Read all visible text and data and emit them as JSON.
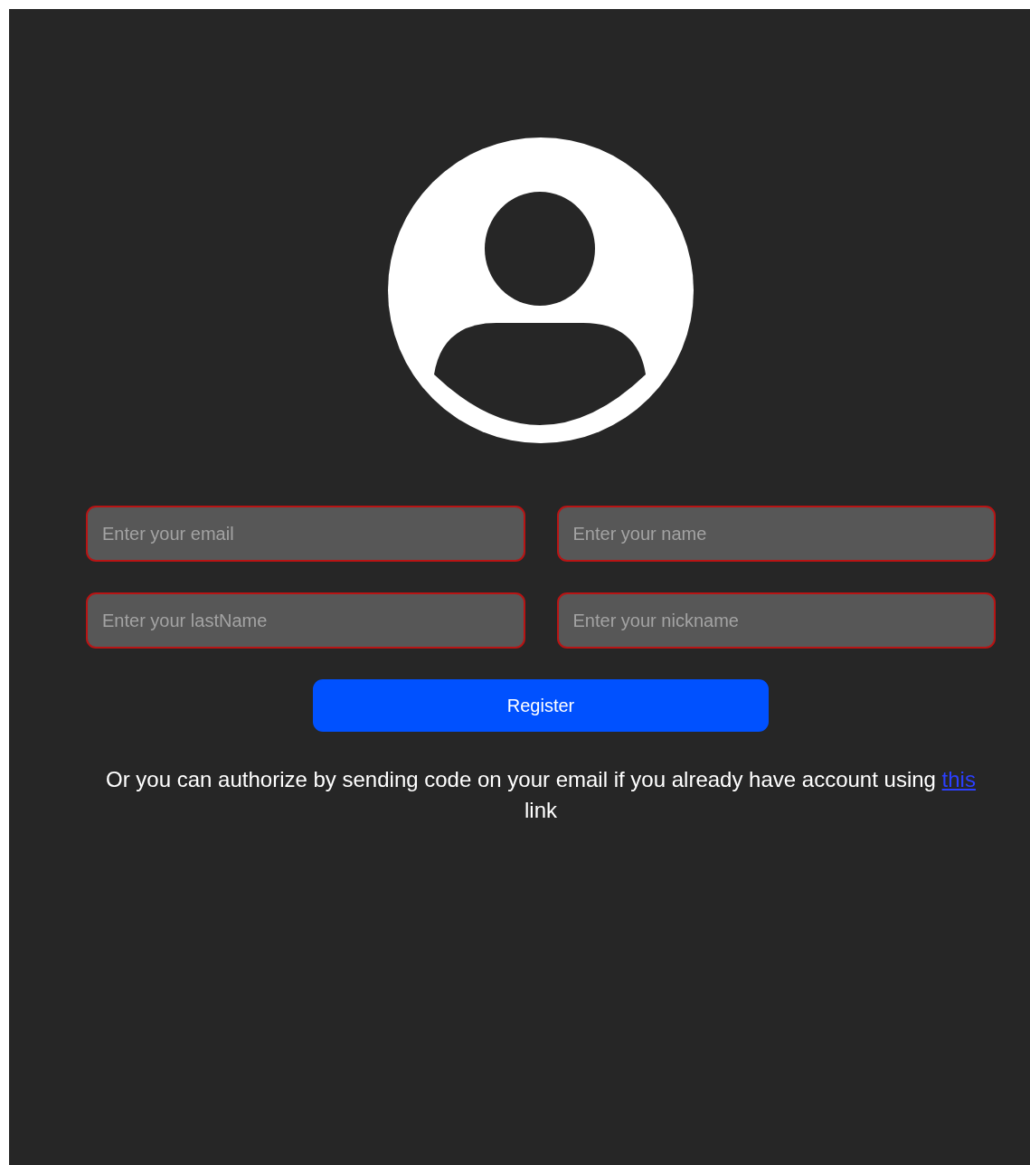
{
  "form": {
    "fields": [
      {
        "placeholder": "Enter your email"
      },
      {
        "placeholder": "Enter your name"
      },
      {
        "placeholder": "Enter your lastName"
      },
      {
        "placeholder": "Enter your nickname"
      }
    ],
    "submit": {
      "label": "Register"
    }
  },
  "note": {
    "before": "Or you can authorize by sending code on your email if you already have account using ",
    "link": "this",
    "after": " link"
  }
}
